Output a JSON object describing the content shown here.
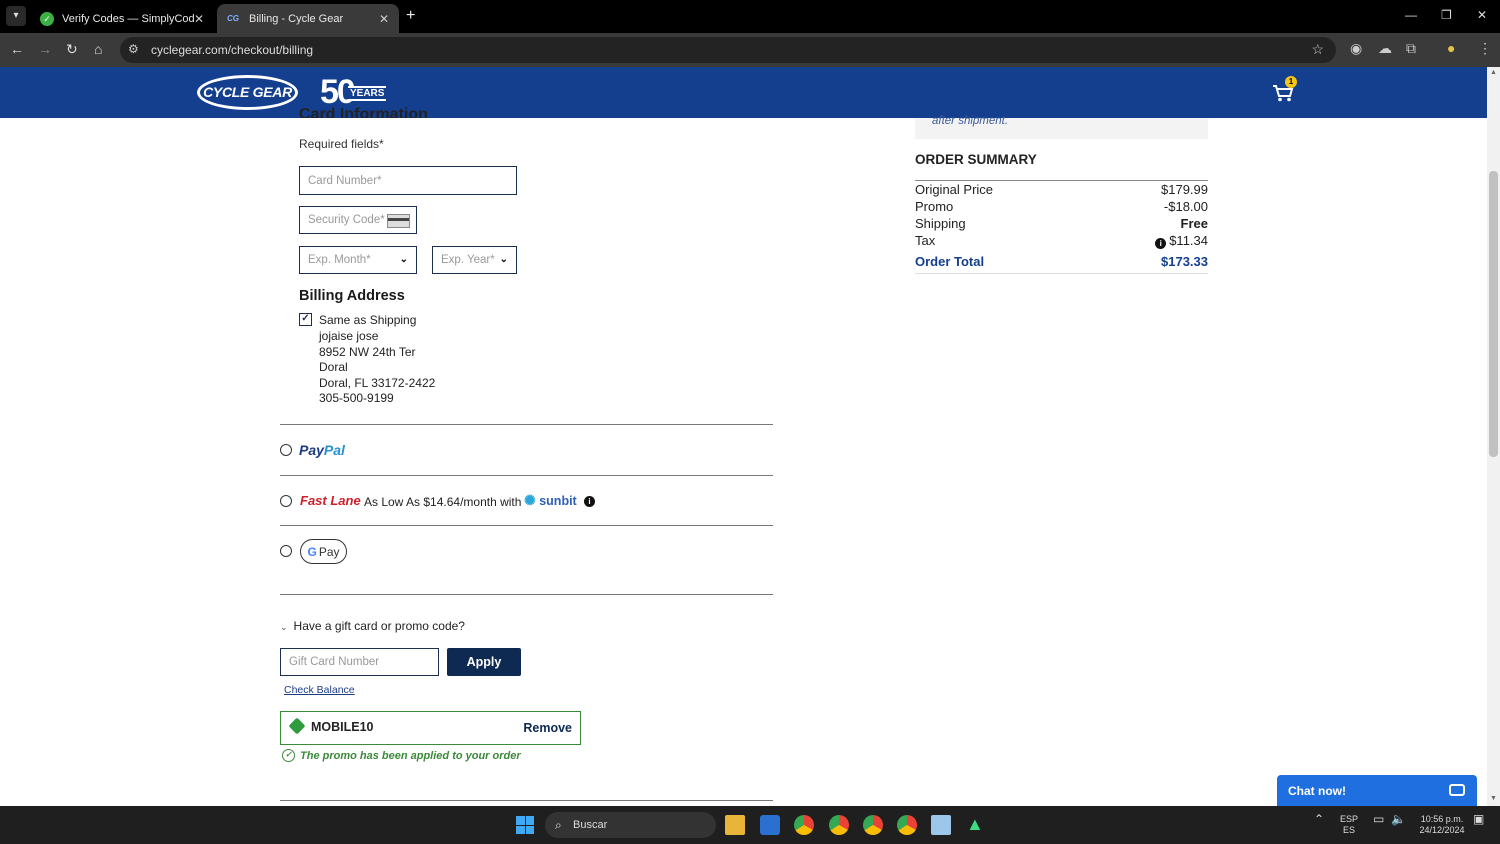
{
  "browser": {
    "tabs": [
      {
        "title": "Verify Codes — SimplyCodes",
        "active": false
      },
      {
        "title": "Billing - Cycle Gear",
        "active": true
      }
    ],
    "url": "cyclegear.com/checkout/billing"
  },
  "site": {
    "logo_text": "CYCLE GEAR",
    "anniversary_number": "50",
    "anniversary_word": "YEARS",
    "cart_count": "1"
  },
  "form": {
    "section_heading": "Card Information",
    "required_note": "Required fields*",
    "card_number_placeholder": "Card Number*",
    "security_code_placeholder": "Security Code*",
    "exp_month_placeholder": "Exp. Month*",
    "exp_year_placeholder": "Exp. Year*"
  },
  "billing": {
    "heading": "Billing Address",
    "same_as_shipping_label": "Same as Shipping",
    "same_as_shipping_checked": true,
    "address_lines": [
      "jojaise jose",
      "8952 NW 24th Ter",
      "Doral",
      "Doral, FL 33172-2422",
      "305-500-9199"
    ]
  },
  "payment_options": {
    "paypal": {
      "part1": "Pay",
      "part2": "Pal"
    },
    "fastlane": {
      "brand": "Fast Lane",
      "text": "As Low As $14.64/month with",
      "partner": "sunbit"
    },
    "gpay": {
      "g": "G",
      "label": "Pay"
    }
  },
  "promo": {
    "toggle_label": "Have a gift card or promo code?",
    "gift_card_placeholder": "Gift Card Number",
    "apply_label": "Apply",
    "check_balance_label": "Check Balance",
    "applied_code": "MOBILE10",
    "remove_label": "Remove",
    "applied_message": "The promo has been applied to your order"
  },
  "summary": {
    "shipping_note": "after shipment.",
    "title": "ORDER SUMMARY",
    "rows": [
      {
        "label": "Original Price",
        "value": "$179.99"
      },
      {
        "label": "Promo",
        "value": "-$18.00"
      },
      {
        "label": "Shipping",
        "value": "Free"
      },
      {
        "label": "Tax",
        "value": "$11.34"
      }
    ],
    "total_label": "Order Total",
    "total_value": "$173.33"
  },
  "chat": {
    "label": "Chat now!"
  },
  "taskbar": {
    "search_placeholder": "Buscar",
    "lang_top": "ESP",
    "lang_bottom": "ES",
    "time": "10:56 p.m.",
    "date": "24/12/2024"
  },
  "colors": {
    "header_blue": "#143f8f",
    "button_navy": "#0f2a52",
    "success_green": "#3a8a3a",
    "fastlane_red": "#d0202a",
    "chat_blue": "#1f6fe0"
  }
}
